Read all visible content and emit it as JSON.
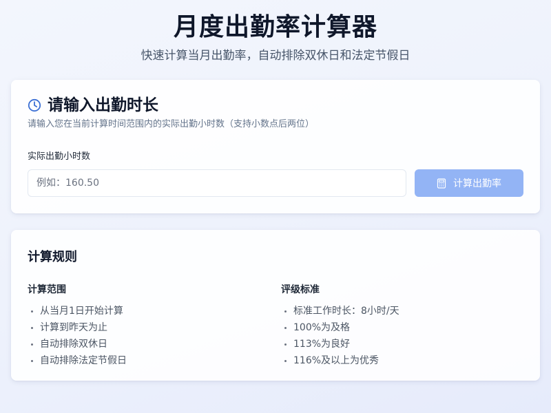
{
  "header": {
    "title": "月度出勤率计算器",
    "subtitle": "快速计算当月出勤率，自动排除双休日和法定节假日"
  },
  "input_card": {
    "icon": "clock-icon",
    "title": "请输入出勤时长",
    "description": "请输入您在当前计算时间范围内的实际出勤小时数（支持小数点后两位）",
    "field_label": "实际出勤小时数",
    "input_value": "",
    "input_placeholder": "例如：160.50",
    "button_icon": "calculator-icon",
    "button_label": "计算出勤率",
    "button_disabled": true
  },
  "rules_card": {
    "title": "计算规则",
    "scope": {
      "heading": "计算范围",
      "items": [
        "从当月1日开始计算",
        "计算到昨天为止",
        "自动排除双休日",
        "自动排除法定节假日"
      ]
    },
    "grading": {
      "heading": "评级标准",
      "items": [
        "标准工作时长：8小时/天",
        "100%为及格",
        "113%为良好",
        "116%及以上为优秀"
      ]
    }
  },
  "colors": {
    "accent": "#3b6fd4",
    "button_disabled_bg": "#93b4f5",
    "title_text": "#0f172a",
    "muted_text": "#64748b"
  }
}
